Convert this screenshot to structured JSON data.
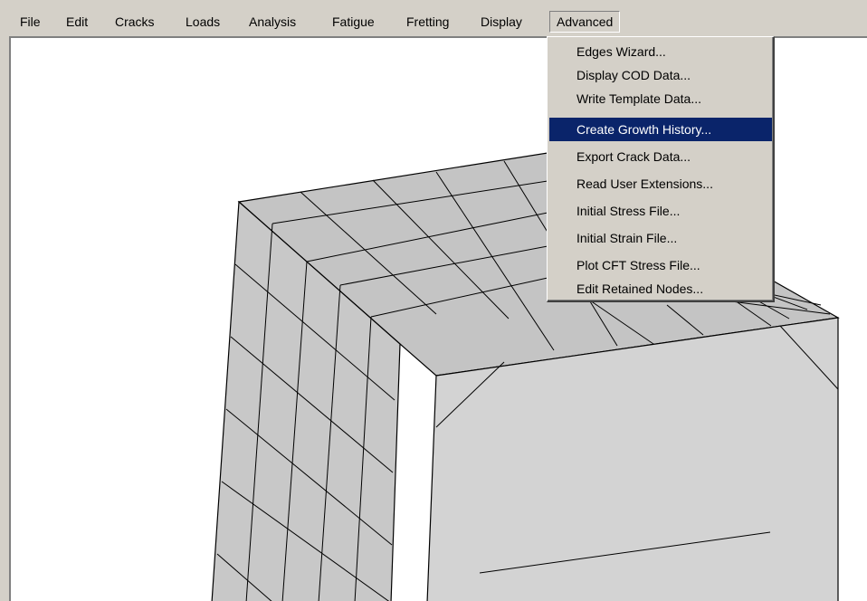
{
  "menubar": {
    "items": [
      {
        "label": "File"
      },
      {
        "label": "Edit"
      },
      {
        "label": "Cracks"
      },
      {
        "label": "Loads"
      },
      {
        "label": "Analysis"
      },
      {
        "label": "Fatigue"
      },
      {
        "label": "Fretting"
      },
      {
        "label": "Display"
      },
      {
        "label": "Advanced"
      }
    ],
    "open_menu": "Advanced"
  },
  "advanced_menu": {
    "items": [
      {
        "label": "Edges Wizard..."
      },
      {
        "label": "Display COD Data..."
      },
      {
        "label": "Write Template Data..."
      },
      {
        "label": "Create Growth History..."
      },
      {
        "label": "Export Crack Data..."
      },
      {
        "label": "Read User Extensions..."
      },
      {
        "label": "Initial Stress File..."
      },
      {
        "label": "Initial Strain File..."
      },
      {
        "label": "Plot CFT Stress File..."
      },
      {
        "label": "Edit Retained Nodes..."
      }
    ],
    "highlighted": "Create Growth History..."
  },
  "colors": {
    "menu_bg": "#d4d0c8",
    "highlight_bg": "#0a246a",
    "highlight_fg": "#ffffff",
    "viewport_bg": "#ffffff",
    "mesh_face_light": "#d3d3d3",
    "mesh_face_dark": "#c0c0c0",
    "mesh_line": "#000000"
  }
}
